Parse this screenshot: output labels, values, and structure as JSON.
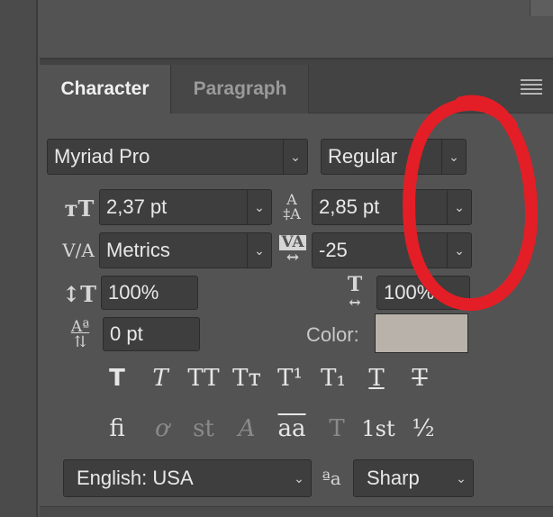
{
  "tabs": {
    "character": "Character",
    "paragraph": "Paragraph"
  },
  "font": {
    "family": "Myriad Pro",
    "style": "Regular"
  },
  "size": {
    "font_size": "2,37 pt",
    "leading": "2,85 pt"
  },
  "kerning": {
    "mode": "Metrics",
    "tracking": "-25"
  },
  "scale": {
    "vertical": "100%",
    "horizontal": "100%"
  },
  "baseline": {
    "shift": "0 pt",
    "color_label": "Color:",
    "color_value": "#b8b2aa"
  },
  "style_buttons": [
    "T",
    "T",
    "TT",
    "Tт",
    "T¹",
    "T₁",
    "T",
    "T"
  ],
  "opentype_buttons": [
    "fi",
    "ơ",
    "st",
    "A",
    "aa",
    "T",
    "1st",
    "½"
  ],
  "language": {
    "value": "English: USA",
    "antialias_icon_text": "ªa",
    "antialias": "Sharp"
  },
  "annotation": {
    "color": "#e41e26"
  }
}
